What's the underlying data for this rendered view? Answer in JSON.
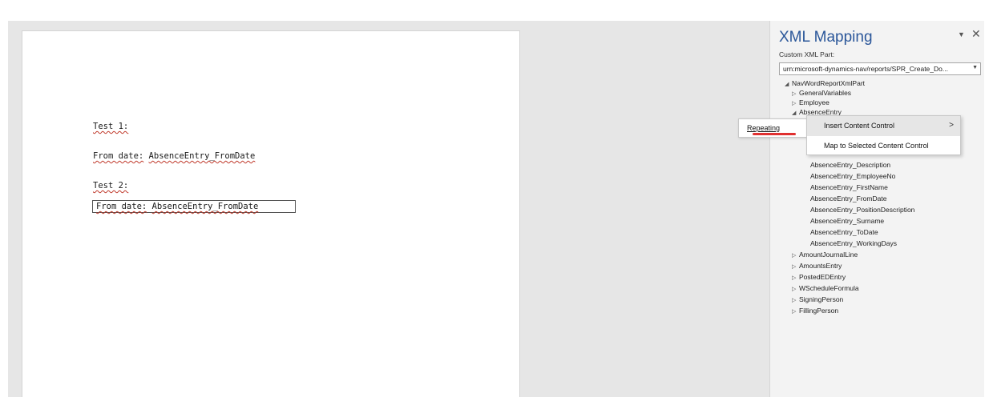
{
  "document": {
    "line1": "Test 1:",
    "line2_label": "From date:",
    "line2_value": "AbsenceEntry_FromDate",
    "line3": "Test 2:",
    "line4_label": "From date:",
    "line4_value": "AbsenceEntry_FromDate"
  },
  "pane": {
    "title": "XML Mapping",
    "custom_part_label": "Custom XML Part:",
    "custom_part_value": "urn:microsoft-dynamics-nav/reports/SPR_Create_Do...",
    "tree": [
      {
        "label": "NavWordReportXmlPart",
        "level": 0,
        "expanded": true
      },
      {
        "label": "GeneralVariables",
        "level": 1,
        "expanded": false
      },
      {
        "label": "Employee",
        "level": 1,
        "expanded": false
      },
      {
        "label": "AbsenceEntry",
        "level": 1,
        "expanded": true
      },
      {
        "label": "AbsenceEntry_Description",
        "level": 2
      },
      {
        "label": "AbsenceEntry_EmployeeNo",
        "level": 2
      },
      {
        "label": "AbsenceEntry_FirstName",
        "level": 2
      },
      {
        "label": "AbsenceEntry_FromDate",
        "level": 2
      },
      {
        "label": "AbsenceEntry_PositionDescription",
        "level": 2
      },
      {
        "label": "AbsenceEntry_Surname",
        "level": 2
      },
      {
        "label": "AbsenceEntry_ToDate",
        "level": 2
      },
      {
        "label": "AbsenceEntry_WorkingDays",
        "level": 2
      },
      {
        "label": "AmountJournalLine",
        "level": 1,
        "expanded": false
      },
      {
        "label": "AmountsEntry",
        "level": 1,
        "expanded": false
      },
      {
        "label": "PostedEDEntry",
        "level": 1,
        "expanded": false
      },
      {
        "label": "WScheduleFormula",
        "level": 1,
        "expanded": false
      },
      {
        "label": "SigningPerson",
        "level": 1,
        "expanded": false
      },
      {
        "label": "FillingPerson",
        "level": 1,
        "expanded": false
      }
    ]
  },
  "context_menu": {
    "submenu_item": "Repeating",
    "items": [
      {
        "label": "Insert Content Control",
        "has_submenu": true
      },
      {
        "label": "Map to Selected Content Control",
        "has_submenu": false
      }
    ]
  },
  "colors": {
    "title": "#2b579a",
    "annotation": "#e03030",
    "spellcheck": "#c0392b"
  },
  "icons": {
    "expanded": "triangle-down-icon",
    "collapsed": "triangle-right-icon",
    "dropdown": "chevron-down-icon",
    "close": "close-icon",
    "submenu": "chevron-right-icon"
  }
}
